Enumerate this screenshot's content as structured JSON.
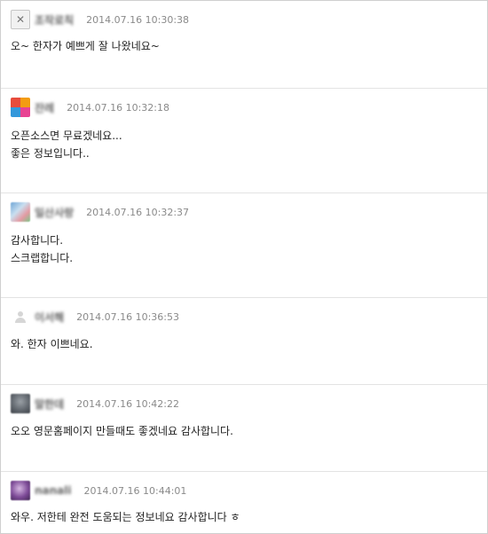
{
  "comments": [
    {
      "nickname": "조작로칙",
      "date": "2014.07.16 10:30:38",
      "avatar": "close-icon",
      "lines": [
        "오~ 한자가 예쁘게 잘 나왔네요~"
      ]
    },
    {
      "nickname": "잔레",
      "date": "2014.07.16 10:32:18",
      "avatar": "colored-blocks-icon",
      "lines": [
        "오픈소스면 무료겠네요...",
        "좋은 정보입니다.."
      ]
    },
    {
      "nickname": "일산사랑",
      "date": "2014.07.16 10:32:37",
      "avatar": "photo-avatar",
      "lines": [
        "감사합니다.",
        "스크랩합니다."
      ]
    },
    {
      "nickname": "이서해",
      "date": "2014.07.16 10:36:53",
      "avatar": "user-icon",
      "lines": [
        "와. 한자 이쁘네요."
      ]
    },
    {
      "nickname": "말한데",
      "date": "2014.07.16 10:42:22",
      "avatar": "photo-avatar",
      "lines": [
        "오오 영문홈페이지 만들때도 좋겠네요 감사합니다."
      ]
    },
    {
      "nickname": "nanali",
      "date": "2014.07.16 10:44:01",
      "avatar": "photo-avatar",
      "lines": [
        "와우. 저한테 완전 도움되는 정보네요 감사합니다 ㅎ"
      ]
    }
  ],
  "colors": {
    "border": "#cfcfcf",
    "divider": "#e3e3e3",
    "date": "#8a8a8a",
    "text": "#222222"
  }
}
